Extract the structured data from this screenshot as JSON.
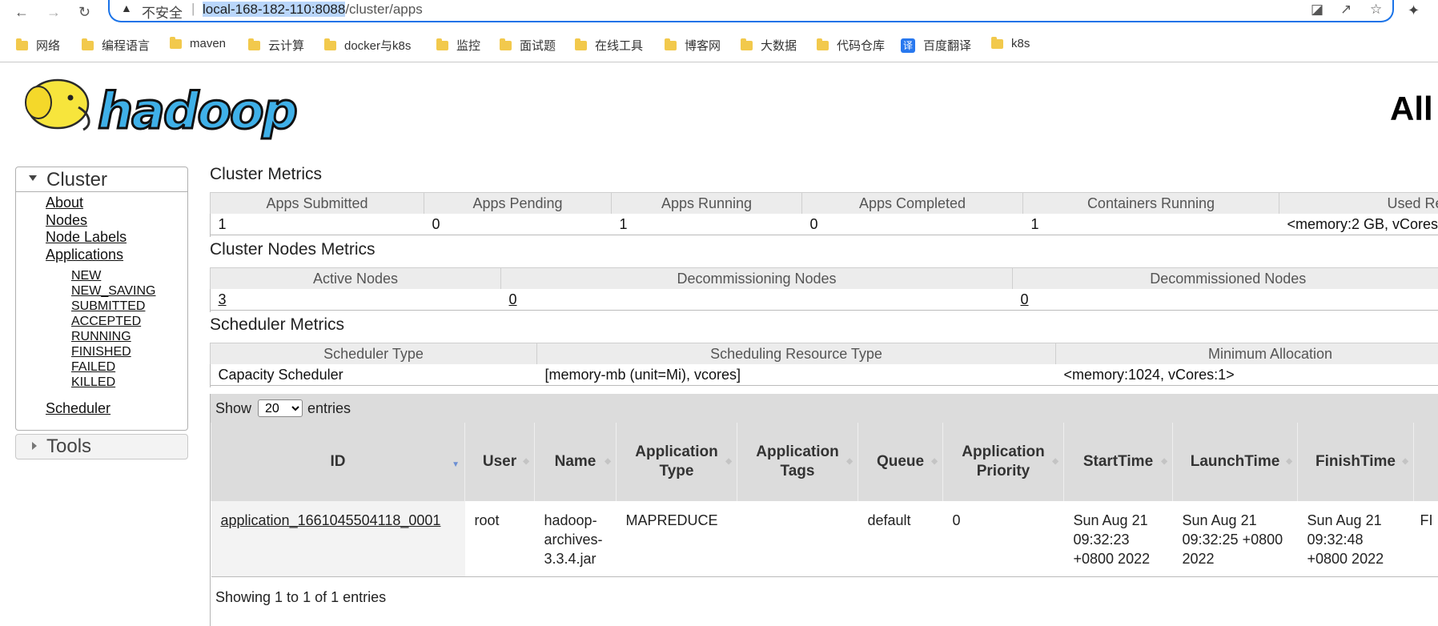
{
  "browser": {
    "back_icon": "arrow-left-icon",
    "forward_icon": "arrow-right-icon",
    "reload_icon": "reload-icon",
    "insecure_label": "不安全",
    "url_host": "local-168-182-110:8088",
    "url_path": "/cluster/apps",
    "accent": "#1a73e8"
  },
  "bookmarks": [
    {
      "label": "网络"
    },
    {
      "label": "编程语言"
    },
    {
      "label": "maven"
    },
    {
      "label": "云计算"
    },
    {
      "label": "docker与k8s"
    },
    {
      "label": "监控"
    },
    {
      "label": "面试题"
    },
    {
      "label": "在线工具"
    },
    {
      "label": "博客网"
    },
    {
      "label": "大数据"
    },
    {
      "label": "代码仓库"
    },
    {
      "label": "百度翻译",
      "badge": "译"
    },
    {
      "label": "k8s"
    }
  ],
  "page": {
    "logo_text": "hadoop",
    "heading": "All"
  },
  "sidebar": {
    "cluster_label": "Cluster",
    "links": [
      "About",
      "Nodes",
      "Node Labels",
      "Applications"
    ],
    "app_states": [
      "NEW",
      "NEW_SAVING",
      "SUBMITTED",
      "ACCEPTED",
      "RUNNING",
      "FINISHED",
      "FAILED",
      "KILLED"
    ],
    "scheduler_label": "Scheduler",
    "tools_label": "Tools"
  },
  "cluster_metrics": {
    "title": "Cluster Metrics",
    "headers": [
      "Apps Submitted",
      "Apps Pending",
      "Apps Running",
      "Apps Completed",
      "Containers Running",
      "Used Re"
    ],
    "values": [
      "1",
      "0",
      "1",
      "0",
      "1",
      "<memory:2 GB, vCores"
    ]
  },
  "node_metrics": {
    "title": "Cluster Nodes Metrics",
    "headers": [
      "Active Nodes",
      "Decommissioning Nodes",
      "Decommissioned Nodes"
    ],
    "values": [
      "3",
      "0",
      "0"
    ]
  },
  "scheduler_metrics": {
    "title": "Scheduler Metrics",
    "headers": [
      "Scheduler Type",
      "Scheduling Resource Type",
      "Minimum Allocation"
    ],
    "values": [
      "Capacity Scheduler",
      "[memory-mb (unit=Mi), vcores]",
      "<memory:1024, vCores:1>"
    ]
  },
  "apps": {
    "show_label": "Show",
    "entries_label": "entries",
    "page_size": "20",
    "columns": [
      "ID",
      "User",
      "Name",
      "Application Type",
      "Application Tags",
      "Queue",
      "Application Priority",
      "StartTime",
      "LaunchTime",
      "FinishTime",
      ""
    ],
    "rows": [
      {
        "id": "application_1661045504118_0001",
        "user": "root",
        "name": "hadoop-archives-3.3.4.jar",
        "type": "MAPREDUCE",
        "tags": "",
        "queue": "default",
        "priority": "0",
        "start": "Sun Aug 21 09:32:23 +0800 2022",
        "launch": "Sun Aug 21 09:32:25 +0800 2022",
        "finish": "Sun Aug 21 09:32:48 +0800 2022",
        "state": "FI"
      }
    ],
    "footer": "Showing 1 to 1 of 1 entries"
  }
}
